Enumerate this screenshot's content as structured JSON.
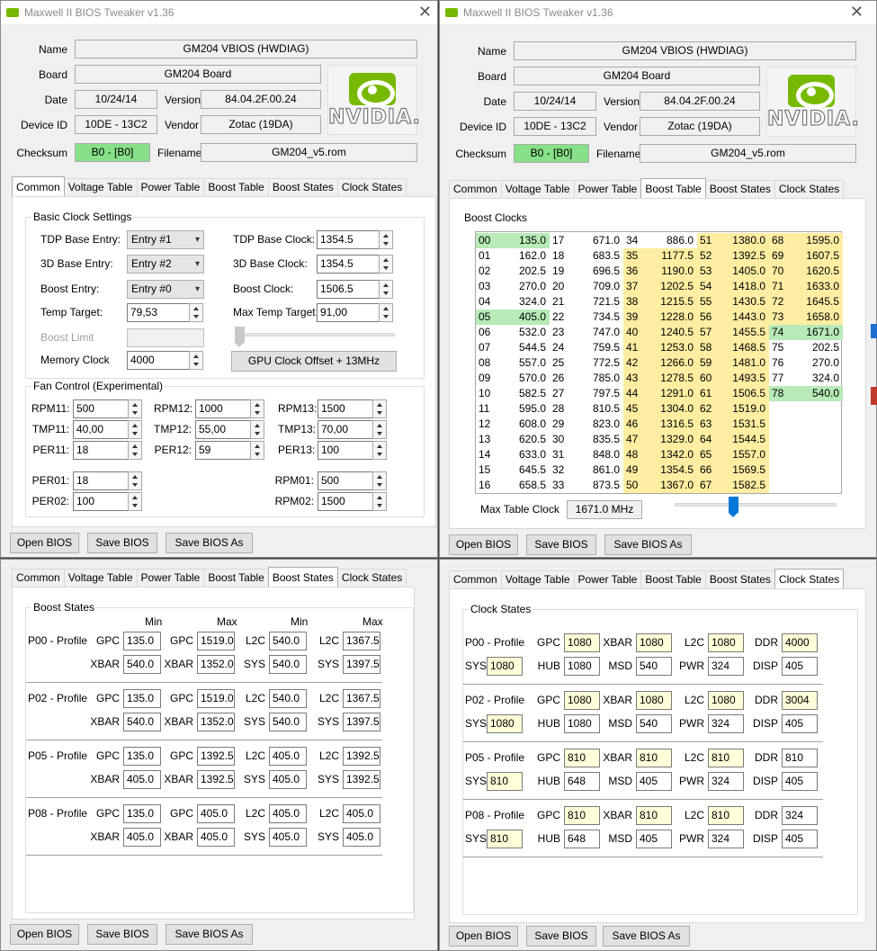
{
  "app_title": "Maxwell II BIOS Tweaker v1.36",
  "header": {
    "name_label": "Name",
    "name": "GM204 VBIOS (HWDIAG)",
    "board_label": "Board",
    "board": "GM204 Board",
    "date_label": "Date",
    "date": "10/24/14",
    "version_label": "Version",
    "version": "84.04.2F.00.24",
    "device_label": "Device ID",
    "device": "10DE - 13C2",
    "vendor_label": "Vendor",
    "vendor": "Zotac (19DA)",
    "checksum_label": "Checksum",
    "checksum": "B0 - [B0]",
    "filename_label": "Filename",
    "filename": "GM204_v5.rom",
    "logo_text": "NVIDIA."
  },
  "tabs": [
    "Common",
    "Voltage Table",
    "Power Table",
    "Boost Table",
    "Boost States",
    "Clock States"
  ],
  "buttons": {
    "open": "Open BIOS",
    "save": "Save BIOS",
    "save_as": "Save BIOS As"
  },
  "common": {
    "basic_title": "Basic Clock Settings",
    "tdp_entry_label": "TDP Base Entry:",
    "tdp_entry": "Entry #1",
    "d3_entry_label": "3D Base Entry:",
    "d3_entry": "Entry #2",
    "boost_entry_label": "Boost Entry:",
    "boost_entry": "Entry #0",
    "temp_target_label": "Temp Target:",
    "temp_target": "79,53",
    "boost_limit_label": "Boost Limit",
    "memory_clock_label": "Memory Clock",
    "memory_clock": "4000",
    "tdp_clock_label": "TDP Base Clock:",
    "tdp_clock": "1354.5",
    "d3_clock_label": "3D Base Clock:",
    "d3_clock": "1354.5",
    "boost_clock_label": "Boost Clock:",
    "boost_clock": "1506.5",
    "max_temp_label": "Max Temp Target:",
    "max_temp": "91,00",
    "offset_button": "GPU Clock Offset + 13MHz",
    "fan_title": "Fan Control (Experimental)",
    "fan": [
      {
        "l1": "RPM11:",
        "v1": "500",
        "l2": "RPM12:",
        "v2": "1000",
        "l3": "RPM13:",
        "v3": "1500"
      },
      {
        "l1": "TMP11:",
        "v1": "40,00",
        "l2": "TMP12:",
        "v2": "55,00",
        "l3": "TMP13:",
        "v3": "70,00"
      },
      {
        "l1": "PER11:",
        "v1": "18",
        "l2": "PER12:",
        "v2": "59",
        "l3": "PER13:",
        "v3": "100"
      }
    ],
    "fan2": [
      {
        "l1": "PER01:",
        "v1": "18",
        "l2": "RPM01:",
        "v2": "500"
      },
      {
        "l1": "PER02:",
        "v1": "100",
        "l2": "RPM02:",
        "v2": "1500"
      }
    ]
  },
  "boost_table": {
    "title": "Boost Clocks",
    "max_label": "Max Table Clock",
    "max_value": "1671.0 MHz",
    "cols": [
      [
        [
          "00",
          "135.0"
        ],
        [
          "01",
          "162.0"
        ],
        [
          "02",
          "202.5"
        ],
        [
          "03",
          "270.0"
        ],
        [
          "04",
          "324.0"
        ],
        [
          "05",
          "405.0"
        ],
        [
          "06",
          "532.0"
        ],
        [
          "07",
          "544.5"
        ],
        [
          "08",
          "557.0"
        ],
        [
          "09",
          "570.0"
        ],
        [
          "10",
          "582.5"
        ],
        [
          "11",
          "595.0"
        ],
        [
          "12",
          "608.0"
        ],
        [
          "13",
          "620.5"
        ],
        [
          "14",
          "633.0"
        ],
        [
          "15",
          "645.5"
        ],
        [
          "16",
          "658.5"
        ]
      ],
      [
        [
          "17",
          "671.0"
        ],
        [
          "18",
          "683.5"
        ],
        [
          "19",
          "696.5"
        ],
        [
          "20",
          "709.0"
        ],
        [
          "21",
          "721.5"
        ],
        [
          "22",
          "734.5"
        ],
        [
          "23",
          "747.0"
        ],
        [
          "24",
          "759.5"
        ],
        [
          "25",
          "772.5"
        ],
        [
          "26",
          "785.0"
        ],
        [
          "27",
          "797.5"
        ],
        [
          "28",
          "810.5"
        ],
        [
          "29",
          "823.0"
        ],
        [
          "30",
          "835.5"
        ],
        [
          "31",
          "848.0"
        ],
        [
          "32",
          "861.0"
        ],
        [
          "33",
          "873.5"
        ]
      ],
      [
        [
          "34",
          "886.0"
        ],
        [
          "35",
          "1177.5"
        ],
        [
          "36",
          "1190.0"
        ],
        [
          "37",
          "1202.5"
        ],
        [
          "38",
          "1215.5"
        ],
        [
          "39",
          "1228.0"
        ],
        [
          "40",
          "1240.5"
        ],
        [
          "41",
          "1253.0"
        ],
        [
          "42",
          "1266.0"
        ],
        [
          "43",
          "1278.5"
        ],
        [
          "44",
          "1291.0"
        ],
        [
          "45",
          "1304.0"
        ],
        [
          "46",
          "1316.5"
        ],
        [
          "47",
          "1329.0"
        ],
        [
          "48",
          "1342.0"
        ],
        [
          "49",
          "1354.5"
        ],
        [
          "50",
          "1367.0"
        ]
      ],
      [
        [
          "51",
          "1380.0"
        ],
        [
          "52",
          "1392.5"
        ],
        [
          "53",
          "1405.0"
        ],
        [
          "54",
          "1418.0"
        ],
        [
          "55",
          "1430.5"
        ],
        [
          "56",
          "1443.0"
        ],
        [
          "57",
          "1455.5"
        ],
        [
          "58",
          "1468.5"
        ],
        [
          "59",
          "1481.0"
        ],
        [
          "60",
          "1493.5"
        ],
        [
          "61",
          "1506.5"
        ],
        [
          "62",
          "1519.0"
        ],
        [
          "63",
          "1531.5"
        ],
        [
          "64",
          "1544.5"
        ],
        [
          "65",
          "1557.0"
        ],
        [
          "66",
          "1569.5"
        ],
        [
          "67",
          "1582.5"
        ]
      ],
      [
        [
          "68",
          "1595.0"
        ],
        [
          "69",
          "1607.5"
        ],
        [
          "70",
          "1620.5"
        ],
        [
          "71",
          "1633.0"
        ],
        [
          "72",
          "1645.5"
        ],
        [
          "73",
          "1658.0"
        ],
        [
          "74",
          "1671.0"
        ],
        [
          "75",
          "202.5"
        ],
        [
          "76",
          "270.0"
        ],
        [
          "77",
          "324.0"
        ],
        [
          "78",
          "540.0"
        ]
      ]
    ]
  },
  "boost_states": {
    "title": "Boost States",
    "headers": [
      "Min",
      "Max",
      "Min",
      "Max"
    ],
    "profiles": [
      {
        "name": "P00 - Profile",
        "r1": [
          [
            "GPC",
            "135.0"
          ],
          [
            "GPC",
            "1519.0"
          ],
          [
            "L2C",
            "540.0"
          ],
          [
            "L2C",
            "1367.5"
          ]
        ],
        "r2": [
          [
            "XBAR",
            "540.0"
          ],
          [
            "XBAR",
            "1352.0"
          ],
          [
            "SYS",
            "540.0"
          ],
          [
            "SYS",
            "1397.5"
          ]
        ]
      },
      {
        "name": "P02 - Profile",
        "r1": [
          [
            "GPC",
            "135.0"
          ],
          [
            "GPC",
            "1519.0"
          ],
          [
            "L2C",
            "540.0"
          ],
          [
            "L2C",
            "1367.5"
          ]
        ],
        "r2": [
          [
            "XBAR",
            "540.0"
          ],
          [
            "XBAR",
            "1352.0"
          ],
          [
            "SYS",
            "540.0"
          ],
          [
            "SYS",
            "1397.5"
          ]
        ]
      },
      {
        "name": "P05 - Profile",
        "r1": [
          [
            "GPC",
            "135.0"
          ],
          [
            "GPC",
            "1392.5"
          ],
          [
            "L2C",
            "405.0"
          ],
          [
            "L2C",
            "1392.5"
          ]
        ],
        "r2": [
          [
            "XBAR",
            "405.0"
          ],
          [
            "XBAR",
            "1392.5"
          ],
          [
            "SYS",
            "405.0"
          ],
          [
            "SYS",
            "1392.5"
          ]
        ]
      },
      {
        "name": "P08 - Profile",
        "r1": [
          [
            "GPC",
            "135.0"
          ],
          [
            "GPC",
            "405.0"
          ],
          [
            "L2C",
            "405.0"
          ],
          [
            "L2C",
            "405.0"
          ]
        ],
        "r2": [
          [
            "XBAR",
            "405.0"
          ],
          [
            "XBAR",
            "405.0"
          ],
          [
            "SYS",
            "405.0"
          ],
          [
            "SYS",
            "405.0"
          ]
        ]
      }
    ]
  },
  "clock_states": {
    "title": "Clock States",
    "profiles": [
      {
        "name": "P00 - Profile",
        "r1": [
          [
            "GPC",
            "1080",
            true
          ],
          [
            "XBAR",
            "1080",
            true
          ],
          [
            "L2C",
            "1080",
            true
          ],
          [
            "DDR",
            "4000",
            true
          ]
        ],
        "r2": [
          [
            "SYS",
            "1080",
            true
          ],
          [
            "HUB",
            "1080",
            false
          ],
          [
            "MSD",
            "540",
            false
          ],
          [
            "PWR",
            "324",
            false
          ],
          [
            "DISP",
            "405",
            false
          ]
        ]
      },
      {
        "name": "P02 - Profile",
        "r1": [
          [
            "GPC",
            "1080",
            true
          ],
          [
            "XBAR",
            "1080",
            true
          ],
          [
            "L2C",
            "1080",
            true
          ],
          [
            "DDR",
            "3004",
            true
          ]
        ],
        "r2": [
          [
            "SYS",
            "1080",
            true
          ],
          [
            "HUB",
            "1080",
            false
          ],
          [
            "MSD",
            "540",
            false
          ],
          [
            "PWR",
            "324",
            false
          ],
          [
            "DISP",
            "405",
            false
          ]
        ]
      },
      {
        "name": "P05 - Profile",
        "r1": [
          [
            "GPC",
            "810",
            true
          ],
          [
            "XBAR",
            "810",
            true
          ],
          [
            "L2C",
            "810",
            true
          ],
          [
            "DDR",
            "810",
            false
          ]
        ],
        "r2": [
          [
            "SYS",
            "810",
            true
          ],
          [
            "HUB",
            "648",
            false
          ],
          [
            "MSD",
            "405",
            false
          ],
          [
            "PWR",
            "324",
            false
          ],
          [
            "DISP",
            "405",
            false
          ]
        ]
      },
      {
        "name": "P08 - Profile",
        "r1": [
          [
            "GPC",
            "810",
            true
          ],
          [
            "XBAR",
            "810",
            true
          ],
          [
            "L2C",
            "810",
            true
          ],
          [
            "DDR",
            "324",
            false
          ]
        ],
        "r2": [
          [
            "SYS",
            "810",
            true
          ],
          [
            "HUB",
            "648",
            false
          ],
          [
            "MSD",
            "405",
            false
          ],
          [
            "PWR",
            "324",
            false
          ],
          [
            "DISP",
            "405",
            false
          ]
        ]
      }
    ]
  }
}
